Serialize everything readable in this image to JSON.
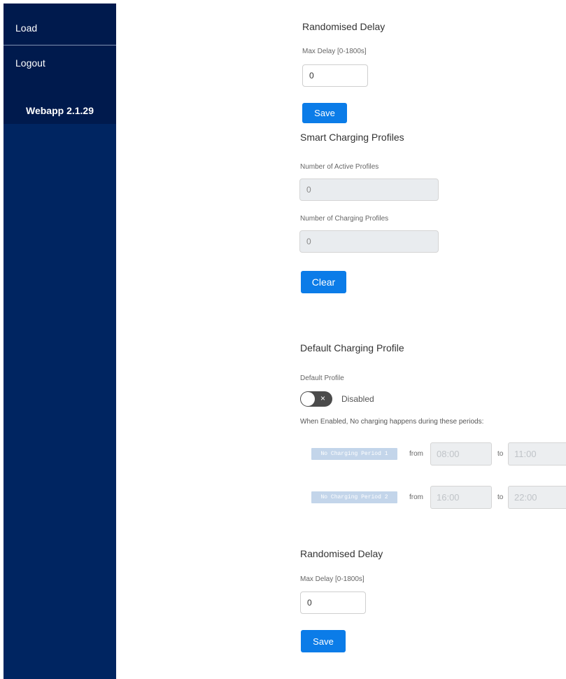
{
  "sidebar": {
    "items": [
      {
        "label": "Load"
      },
      {
        "label": "Logout"
      }
    ],
    "version": "Webapp 2.1.29"
  },
  "randomised_delay_top": {
    "title": "Randomised Delay",
    "label": "Max Delay [0-1800s]",
    "value": "0",
    "save_label": "Save"
  },
  "smart_charging": {
    "title": "Smart Charging Profiles",
    "active_label": "Number of Active Profiles",
    "active_value": "0",
    "charging_label": "Number of Charging Profiles",
    "charging_value": "0",
    "clear_label": "Clear"
  },
  "default_profile": {
    "title": "Default Charging Profile",
    "label": "Default Profile",
    "toggle_state": "Disabled",
    "toggle_icon": "×",
    "hint": "When Enabled, No charging happens during these periods:",
    "periods": [
      {
        "tag": "No Charging Period 1",
        "from_label": "from",
        "from": "08:00",
        "to_label": "to",
        "to": "11:00"
      },
      {
        "tag": "No Charging Period 2",
        "from_label": "from",
        "from": "16:00",
        "to_label": "to",
        "to": "22:00"
      }
    ]
  },
  "randomised_delay_bottom": {
    "title": "Randomised Delay",
    "label": "Max Delay [0-1800s]",
    "value": "0",
    "save_label": "Save"
  }
}
